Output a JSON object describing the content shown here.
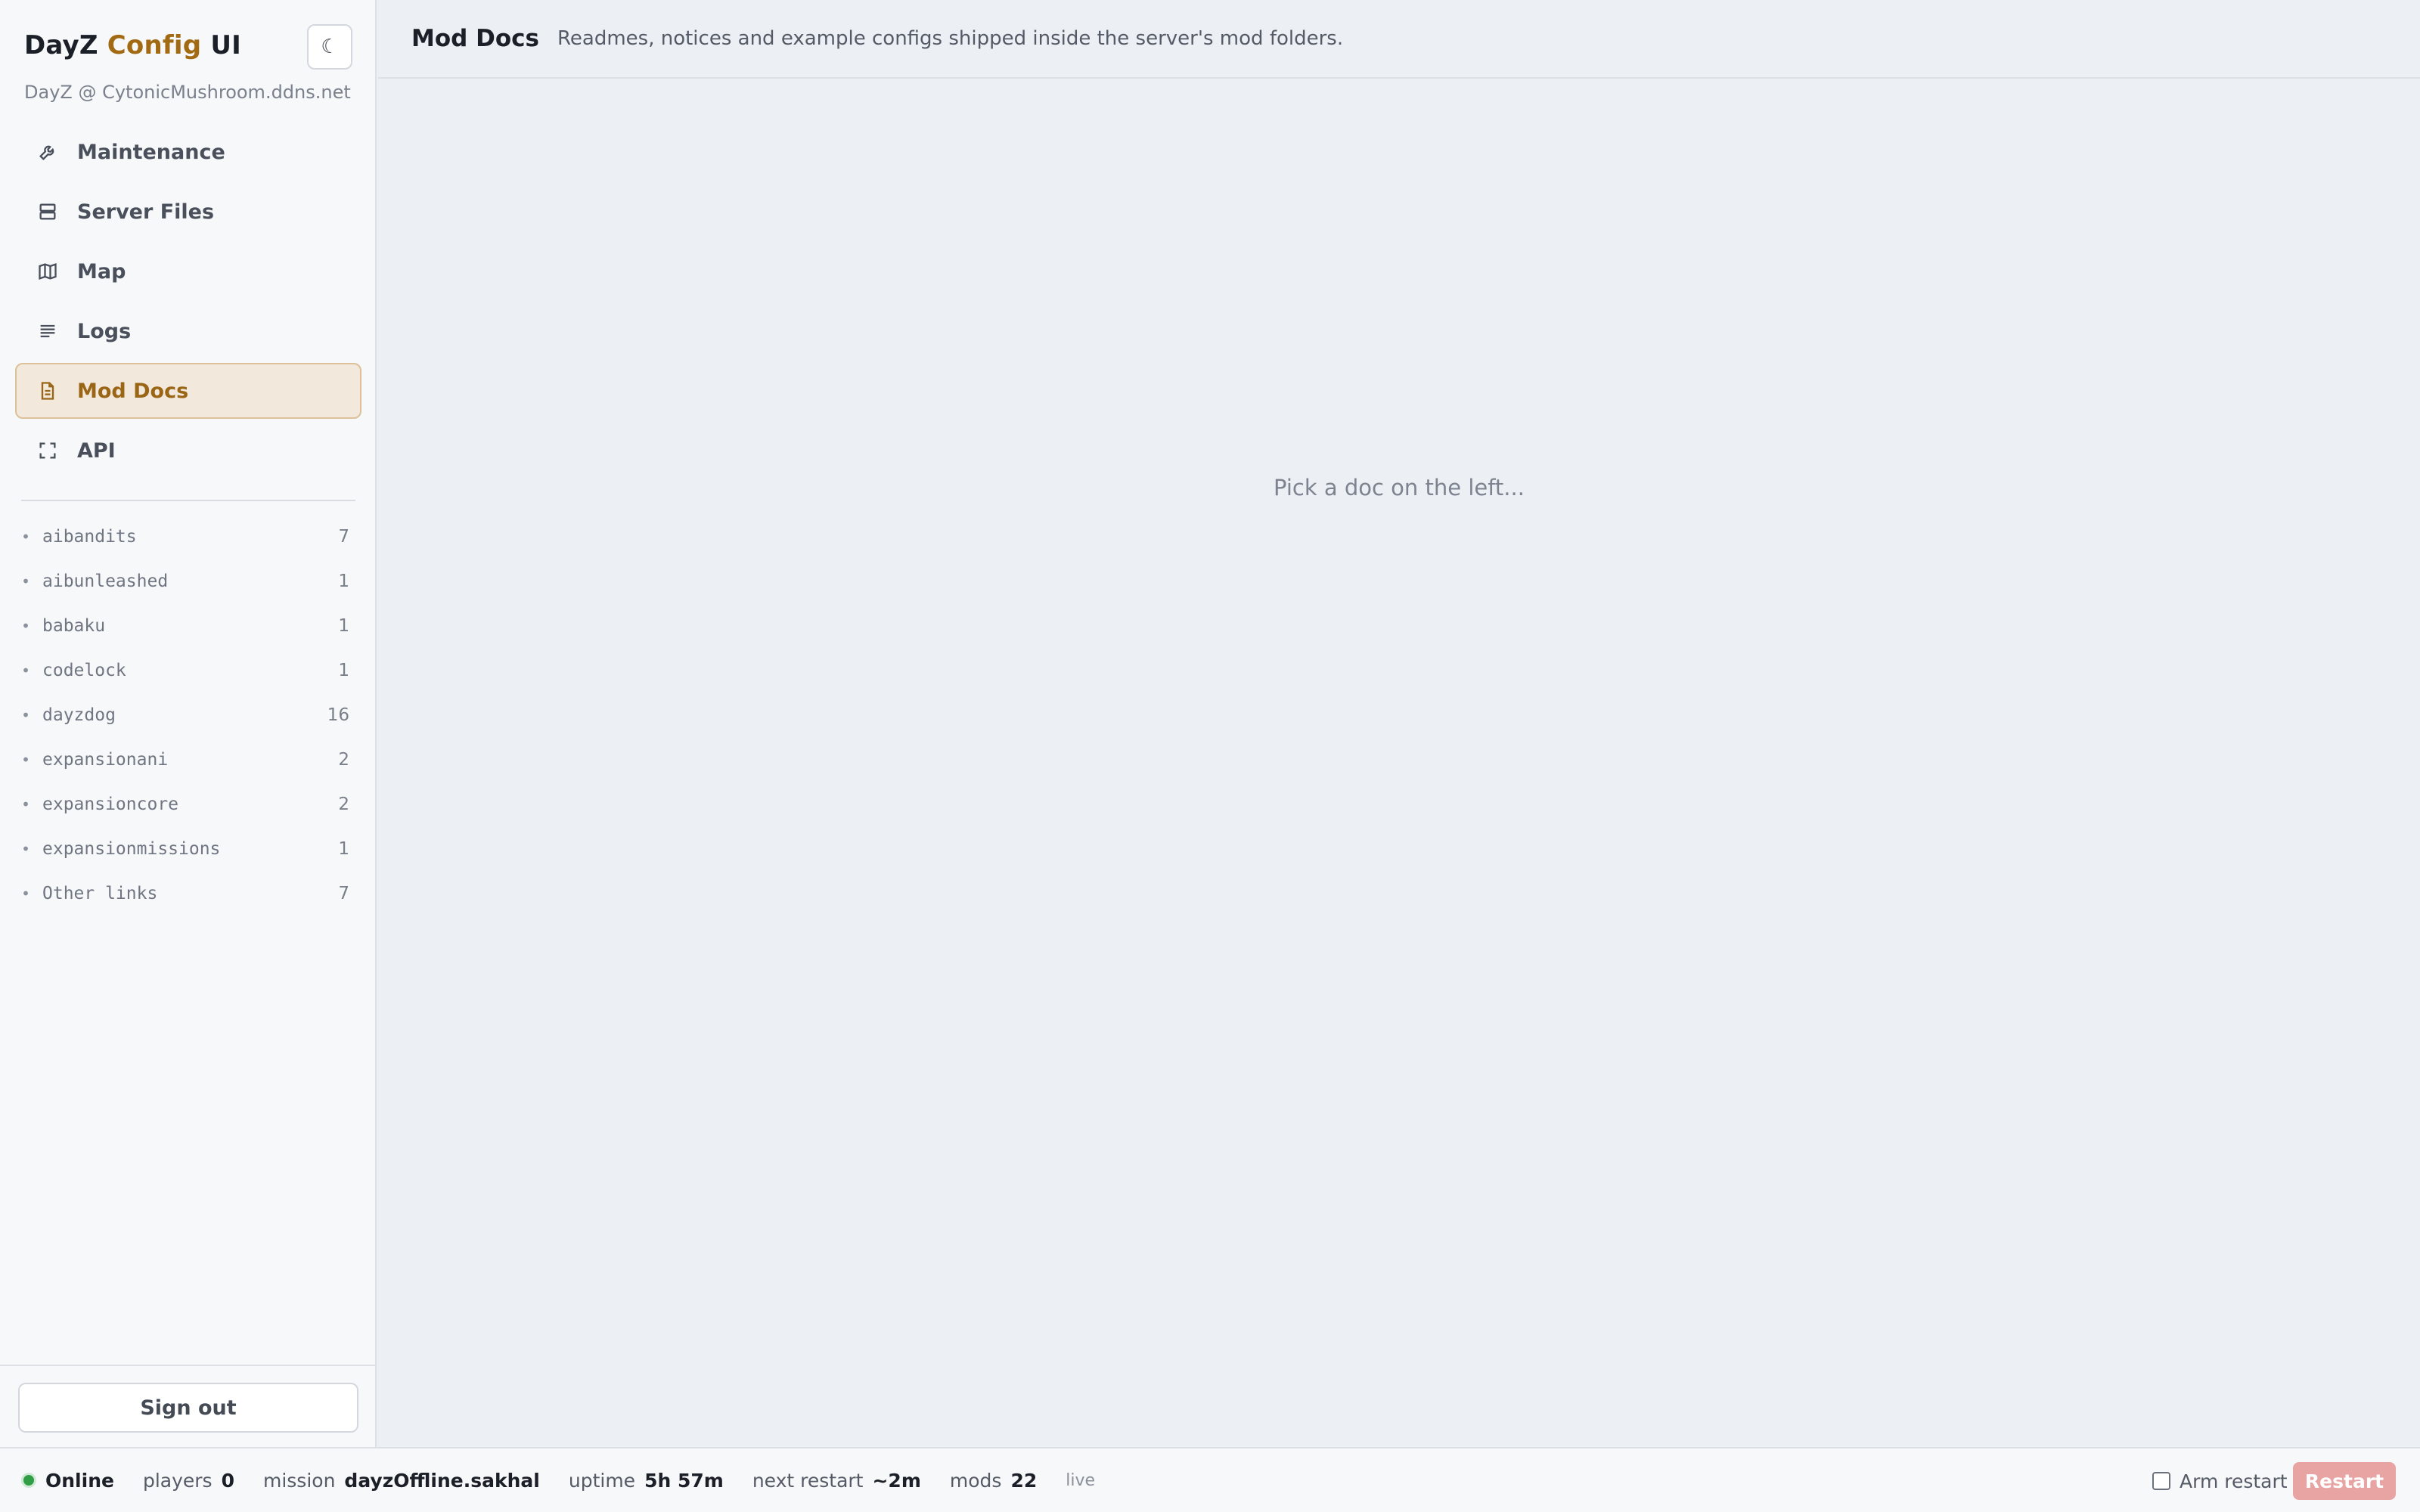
{
  "app": {
    "title_prefix": "DayZ ",
    "title_accent": "Config",
    "title_suffix": " UI",
    "host": "DayZ @ CytonicMushroom.ddns.net",
    "theme_toggle_glyph": "☾"
  },
  "nav": [
    {
      "label": "Maintenance",
      "icon": "wrench-icon"
    },
    {
      "label": "Server Files",
      "icon": "server-icon"
    },
    {
      "label": "Map",
      "icon": "map-icon"
    },
    {
      "label": "Logs",
      "icon": "logs-icon"
    },
    {
      "label": "Mod Docs",
      "icon": "document-icon",
      "active": true
    },
    {
      "label": "API",
      "icon": "brackets-icon"
    }
  ],
  "mods": [
    {
      "name": "aibandits",
      "count": "7"
    },
    {
      "name": "aibunleashed",
      "count": "1"
    },
    {
      "name": "babaku",
      "count": "1"
    },
    {
      "name": "codelock",
      "count": "1"
    },
    {
      "name": "dayzdog",
      "count": "16"
    },
    {
      "name": "expansionani",
      "count": "2"
    },
    {
      "name": "expansioncore",
      "count": "2"
    },
    {
      "name": "expansionmissions",
      "count": "1"
    },
    {
      "name": "Other links",
      "count": "7"
    }
  ],
  "sidebar": {
    "bullet": "•",
    "signout_label": "Sign out"
  },
  "main": {
    "title": "Mod Docs",
    "subtitle": "Readmes, notices and example configs shipped inside the server's mod folders.",
    "empty_hint": "Pick a doc on the left..."
  },
  "status": {
    "state": "Online",
    "state_color": "#2f9e44",
    "players_label": "players",
    "players_value": "0",
    "mission_label": "mission",
    "mission_value": "dayzOffline.sakhal",
    "uptime_label": "uptime",
    "uptime_value": "5h 57m",
    "next_restart_label": "next restart",
    "next_restart_value": "~2m",
    "mods_label": "mods",
    "mods_value": "22",
    "live_label": "live",
    "arm_restart_label": "Arm restart",
    "restart_label": "Restart"
  },
  "colors": {
    "accent": "#a26a12",
    "active_bg": "#f2e8dc",
    "restart_btn": "#e8a3a3"
  }
}
